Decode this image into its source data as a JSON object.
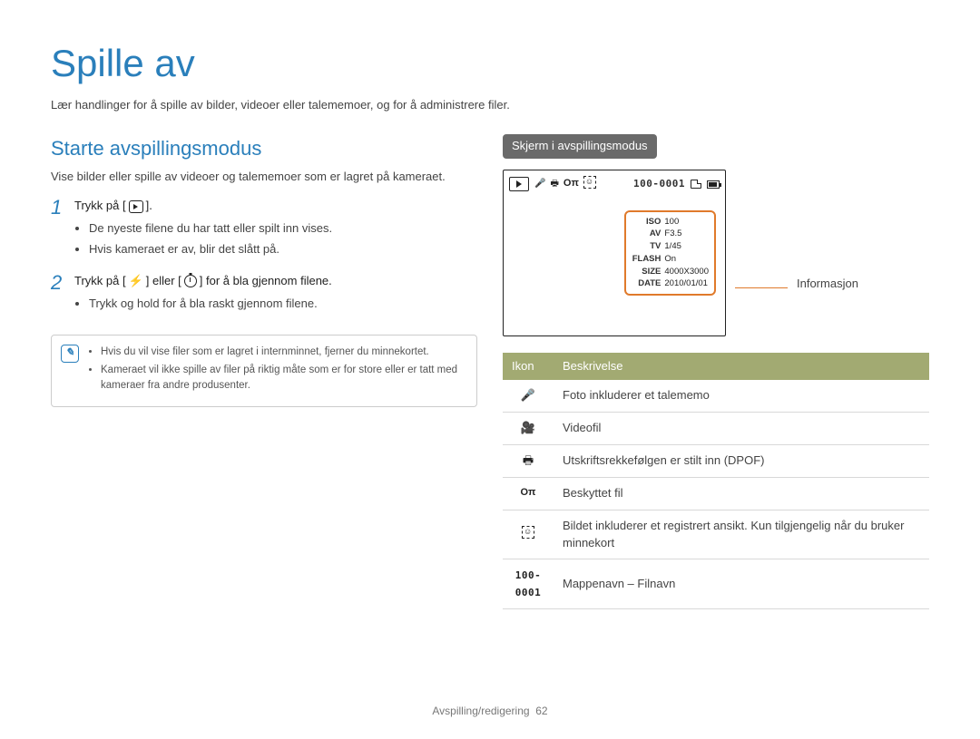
{
  "title": "Spille av",
  "subtitle": "Lær handlinger for å spille av bilder, videoer eller talememoer, og for å administrere filer.",
  "left": {
    "heading": "Starte avspillingsmodus",
    "intro": "Vise bilder eller spille av videoer og talememoer som er lagret på kameraet.",
    "step1": {
      "num": "1",
      "prefix": "Trykk på [",
      "suffix": "].",
      "bullets": [
        "De nyeste filene du har tatt eller spilt inn vises.",
        "Hvis kameraet er av, blir det slått på."
      ]
    },
    "step2": {
      "num": "2",
      "p1": "Trykk på [",
      "mid": "] eller [",
      "p2": "] for å bla gjennom filene.",
      "bullets": [
        "Trykk og hold for å bla raskt gjennom filene."
      ]
    },
    "note": [
      "Hvis du vil vise filer som er lagret i internminnet, fjerner du minnekortet.",
      "Kameraet vil ikke spille av filer på riktig måte som er for store eller er tatt med kameraer fra andre produsenter."
    ]
  },
  "right": {
    "chip": "Skjerm i avspillingsmodus",
    "fileno": "100-0001",
    "info_label": "Informasjon",
    "info": {
      "ISO": "100",
      "AV": "F3.5",
      "TV": "1/45",
      "FLASH": "On",
      "SIZE": "4000X3000",
      "DATE": "2010/01/01"
    },
    "table": {
      "h1": "Ikon",
      "h2": "Beskrivelse",
      "rows": [
        {
          "icon": "mic",
          "text": "Foto inkluderer et talememo"
        },
        {
          "icon": "vid",
          "text": "Videofil"
        },
        {
          "icon": "print",
          "text": "Utskriftsrekkefølgen er stilt inn (DPOF)"
        },
        {
          "icon": "key",
          "text": "Beskyttet fil"
        },
        {
          "icon": "face",
          "text": "Bildet inkluderer et registrert ansikt. Kun tilgjengelig når du bruker minnekort"
        },
        {
          "icon": "fileno",
          "text": "Mappenavn – Filnavn"
        }
      ]
    }
  },
  "footer": {
    "section": "Avspilling/redigering",
    "page": "62"
  }
}
